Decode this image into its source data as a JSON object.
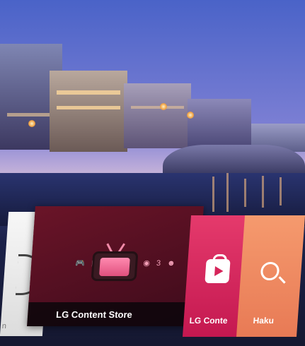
{
  "launcher": {
    "partial_card_label": "n",
    "featured": {
      "label": "LG Content Store",
      "icon": "retro-tv-icon",
      "glyphs_left": "🎮 ▣",
      "glyphs_right": "◉ 3 ☻"
    },
    "tiles": [
      {
        "label": "LG Conte",
        "icon": "shopping-bag-play-icon",
        "color": "#d6255a"
      },
      {
        "label": "Haku",
        "icon": "search-icon",
        "color": "#ef8a60"
      }
    ]
  }
}
